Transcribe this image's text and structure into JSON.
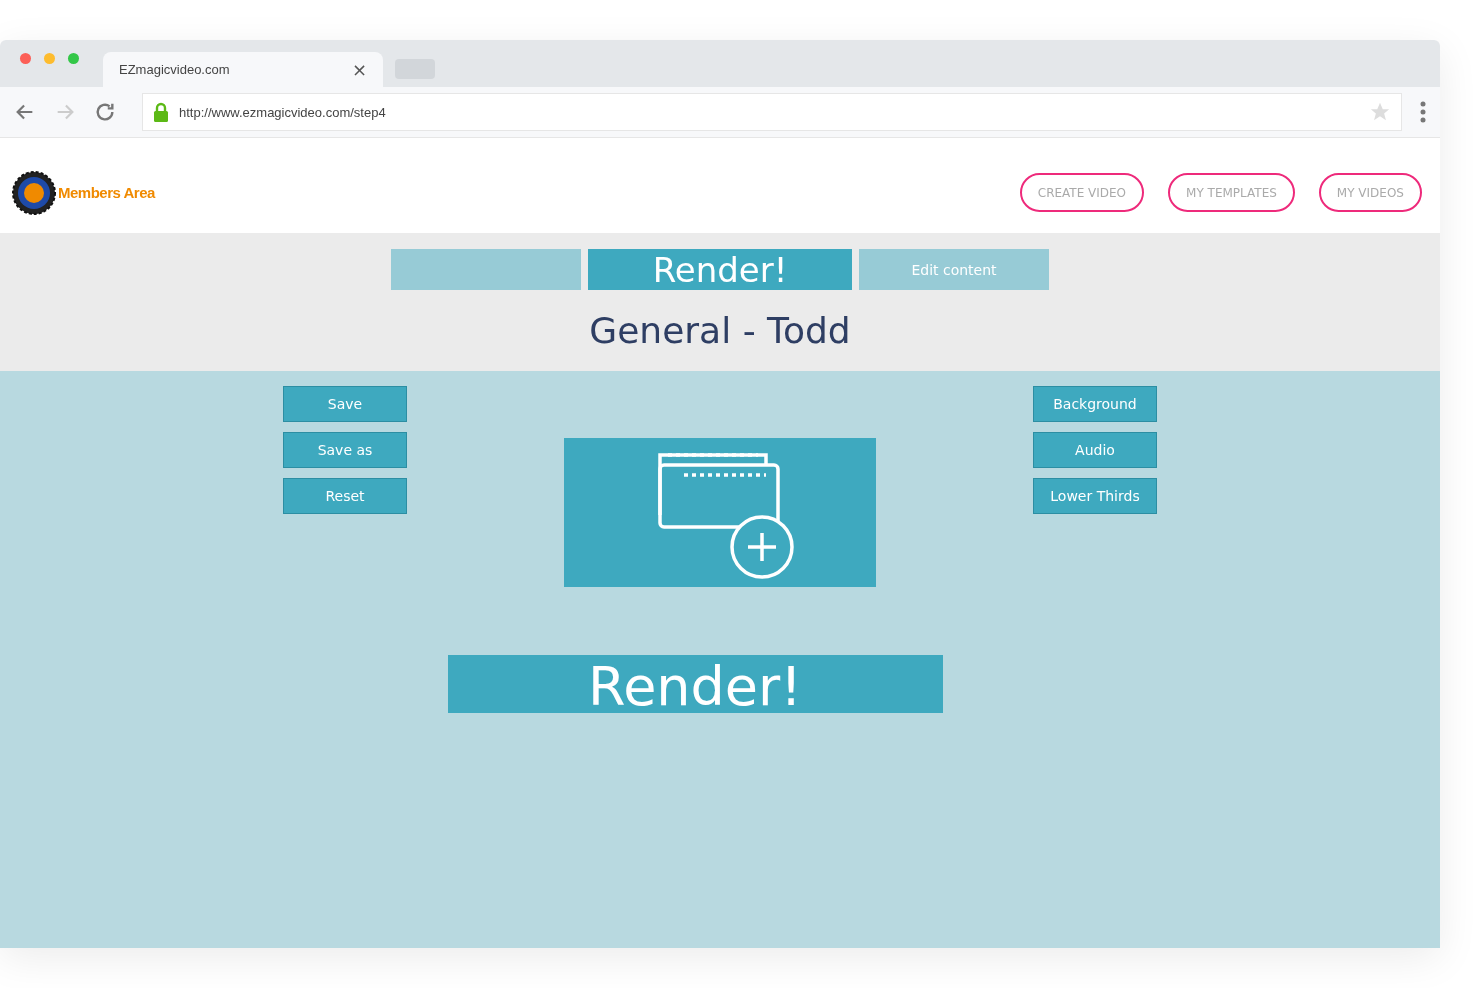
{
  "browser": {
    "tab_title": "EZmagicvideo.com",
    "close": "×",
    "url": "http://www.ezmagicvideo.com/step4"
  },
  "header": {
    "logo_text": "Members Area",
    "nav": [
      "CREATE VIDEO",
      "MY TEMPLATES",
      "MY VIDEOS"
    ]
  },
  "steps": [
    {
      "selected": false
    },
    {
      "label": "Render!",
      "selected": true
    },
    {
      "label": "Edit content",
      "selected": false
    }
  ],
  "title": "General - Todd",
  "left_buttons": [
    "Save",
    "Save as",
    "Reset"
  ],
  "right_buttons": [
    "Background",
    "Audio",
    "Lower Thirds"
  ],
  "render_button": "Render!"
}
